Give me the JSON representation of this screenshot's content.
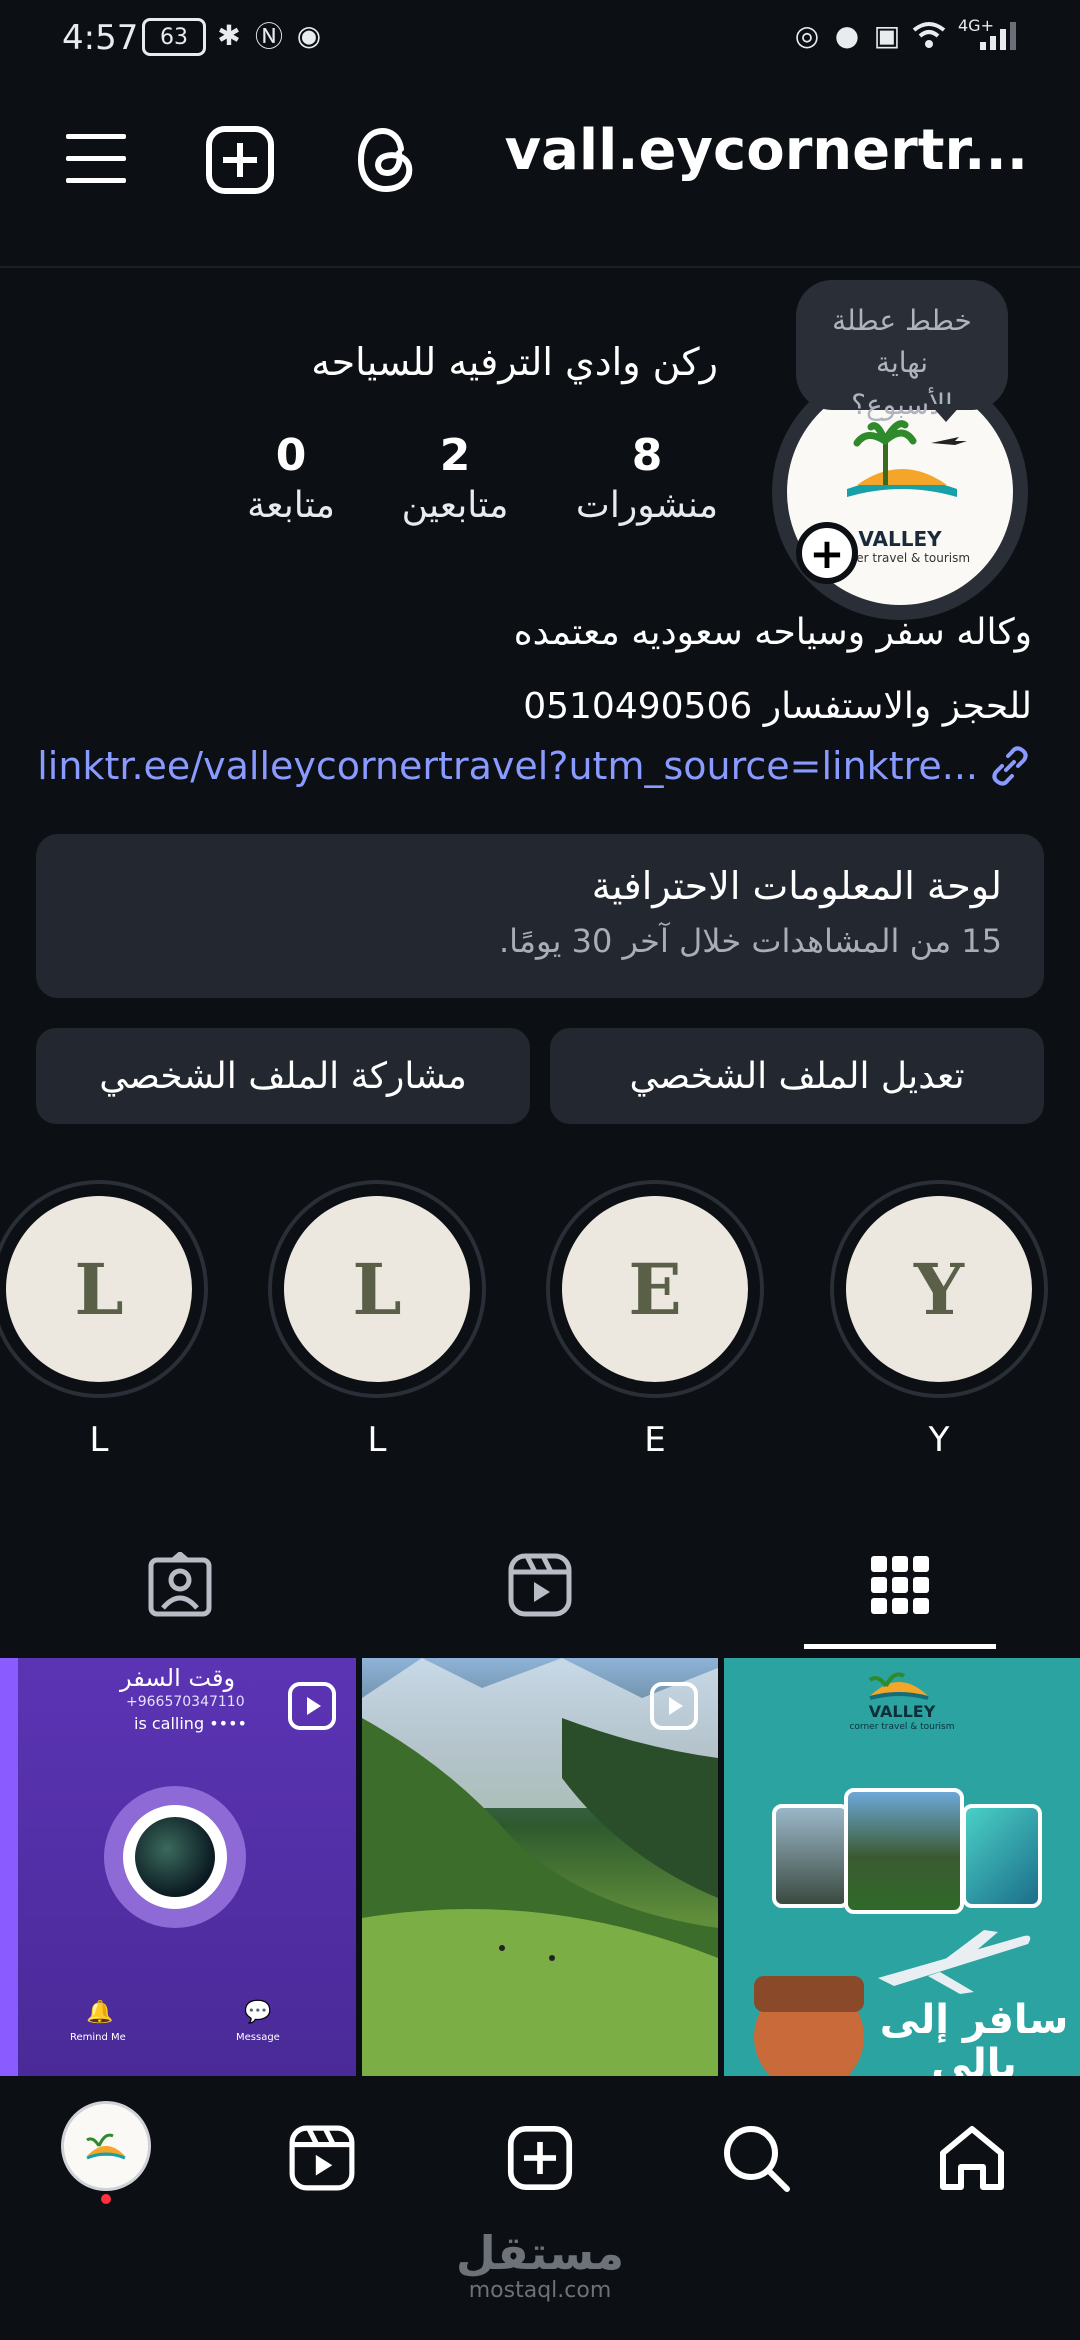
{
  "status_bar": {
    "time": "4:57",
    "battery": "63",
    "network": "4G+"
  },
  "header": {
    "username": "vall.eycornertr...",
    "icons": [
      "menu-icon",
      "add-icon",
      "threads-icon"
    ]
  },
  "profile": {
    "full_name": "ركن وادي الترفيه للسياحه",
    "avatar_text": "VALLEY",
    "avatar_subtext": "corner travel & tourism",
    "note_bubble": "خطط عطلة نهاية الأسبوع؟",
    "stats": [
      {
        "value": "8",
        "label": "منشورات"
      },
      {
        "value": "2",
        "label": "متابعين"
      },
      {
        "value": "0",
        "label": "متابعة"
      }
    ],
    "bio_line1": "وكاله سفر وسياحه سعوديه معتمده",
    "bio_line2": "للحجز والاستفسار 0510490506",
    "link": "linktr.ee/valleycornertravel?utm_source=linktre..."
  },
  "dashboard": {
    "title": "لوحة المعلومات الاحترافية",
    "subtitle": "15 من المشاهدات خلال آخر 30 يومًا."
  },
  "actions": {
    "edit_profile": "تعديل الملف الشخصي",
    "share_profile": "مشاركة الملف الشخصي"
  },
  "highlights": [
    {
      "letter": "Y",
      "label": "Y"
    },
    {
      "letter": "E",
      "label": "E"
    },
    {
      "letter": "L",
      "label": "L"
    },
    {
      "letter": "L",
      "label": "L"
    }
  ],
  "tabs": [
    "grid-icon",
    "reels-icon",
    "tagged-icon"
  ],
  "posts": [
    {
      "title": "وقت السفر",
      "phone": "+966570347110",
      "calling": "is calling ••••",
      "left_action": "Remind Me",
      "right_action": "Message"
    },
    {
      "type": "landscape"
    },
    {
      "brand": "VALLEY",
      "brand_sub": "corner travel & tourism",
      "headline": "سافر إلى بالي"
    }
  ],
  "watermark": {
    "arabic": "مستقل",
    "latin": "mostaql.com"
  },
  "colors": {
    "background": "#0c0f14",
    "card": "#23272f",
    "link": "#8a9bff",
    "accent_red": "#ff3040"
  }
}
